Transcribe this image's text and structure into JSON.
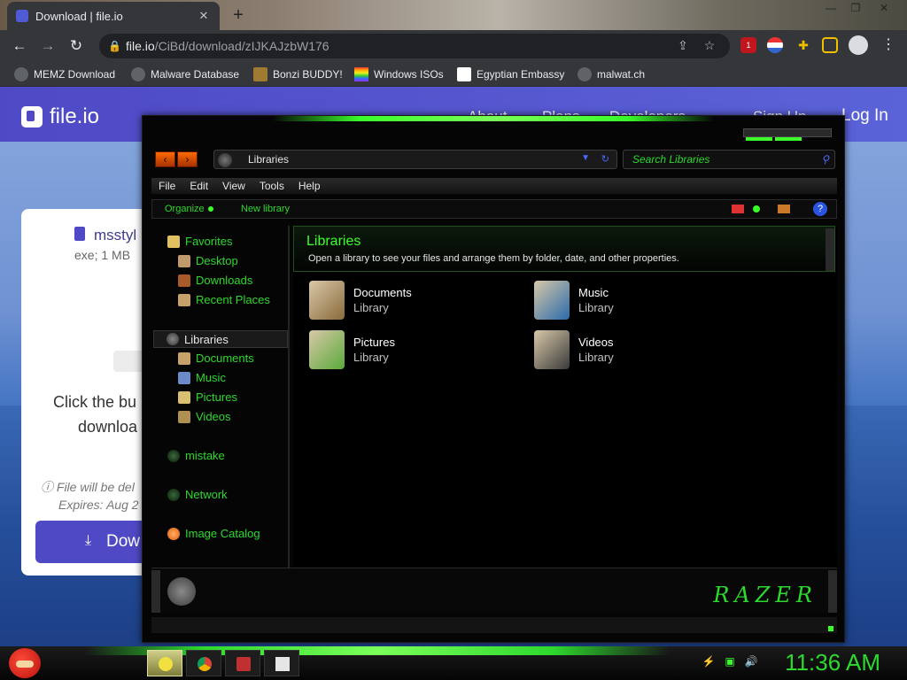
{
  "browser": {
    "tab_title": "Download | file.io",
    "tab_close": "✕",
    "new_tab": "+",
    "window_controls": [
      "—",
      "❐",
      "✕"
    ],
    "nav": {
      "back": "←",
      "forward": "→",
      "reload": "↻"
    },
    "url_host": "file.io",
    "url_path": "/CiBd/download/zIJKAJzbW176",
    "omnibox_icons": {
      "lock": "🔒",
      "share": "⇪",
      "star": "☆"
    },
    "extension_badge": "1",
    "bookmarks": [
      "MEMZ Download",
      "Malware Database",
      "Bonzi BUDDY!",
      "Windows ISOs",
      "Egyptian Embassy",
      "malwat.ch"
    ]
  },
  "fileio": {
    "logo_text": "file.io",
    "nav": [
      "About",
      "Plans",
      "Developers",
      "Sign Up",
      "Log In"
    ],
    "card": {
      "file_name": "msstyl",
      "file_meta": "exe; 1 MB",
      "message_line1": "Click the bu",
      "message_line2": "downloa",
      "expiry_line1": "File will be del",
      "expiry_line2": "Expires: Aug 2",
      "download_label": "Dow"
    }
  },
  "explorer": {
    "address": "Libraries",
    "search_placeholder": "Search Libraries",
    "menu": [
      "File",
      "Edit",
      "View",
      "Tools",
      "Help"
    ],
    "commands": {
      "organize": "Organize",
      "new_library": "New library",
      "help": "?"
    },
    "nav_tree": {
      "favorites": "Favorites",
      "favorites_items": [
        "Desktop",
        "Downloads",
        "Recent Places"
      ],
      "libraries": "Libraries",
      "libraries_items": [
        "Documents",
        "Music",
        "Pictures",
        "Videos"
      ],
      "mistake": "mistake",
      "network": "Network",
      "image_catalog": "Image Catalog"
    },
    "header": {
      "title": "Libraries",
      "description": "Open a library to see your files and arrange them by folder, date, and other properties."
    },
    "libraries": [
      {
        "name": "Documents",
        "type": "Library"
      },
      {
        "name": "Music",
        "type": "Library"
      },
      {
        "name": "Pictures",
        "type": "Library"
      },
      {
        "name": "Videos",
        "type": "Library"
      }
    ],
    "brand": "RAZER"
  },
  "taskbar": {
    "clock": "11:36 AM",
    "tray": {
      "action_center": "⚡",
      "battery": "▣",
      "volume": "🔊"
    }
  },
  "colors": {
    "accent_green": "#2cd92c",
    "fileio_purple": "#4f49c6",
    "chrome_dark": "#35363a"
  }
}
